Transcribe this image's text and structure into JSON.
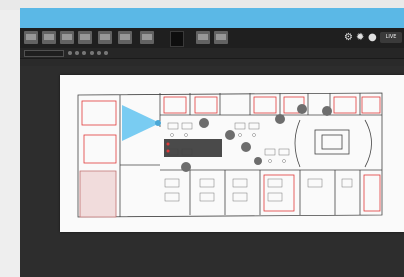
{
  "app": {
    "title": "",
    "colors": {
      "accent_bar": "#5bb8e6",
      "toolbar": "#1f1f1f",
      "canvas": "#2d2d2d",
      "sheet": "#fafafa",
      "hazard": "#e03a3a",
      "marker": "#6d6d6d",
      "sensor": "#62c3f0"
    }
  },
  "toolbar": {
    "buttons": [
      {
        "icon": "select-icon",
        "label": ""
      },
      {
        "icon": "pan-icon",
        "label": ""
      },
      {
        "icon": "import-icon",
        "label": ""
      },
      {
        "icon": "export-icon",
        "label": ""
      },
      {
        "icon": "wall-icon",
        "label": ""
      },
      {
        "icon": "area-icon",
        "label": ""
      },
      {
        "icon": "door-icon",
        "label": ""
      }
    ],
    "right_buttons": [
      {
        "icon": "save-icon",
        "label": ""
      },
      {
        "icon": "print-icon",
        "label": ""
      }
    ],
    "status_icons": [
      "gear-icon",
      "lightbulb-icon",
      "user-icon"
    ],
    "status_text": "LIVE"
  },
  "subbar": {
    "project_name": "",
    "zoom": ""
  },
  "canvas": {
    "coordinates": "",
    "tooltip": {
      "line1": "",
      "line2": ""
    }
  }
}
